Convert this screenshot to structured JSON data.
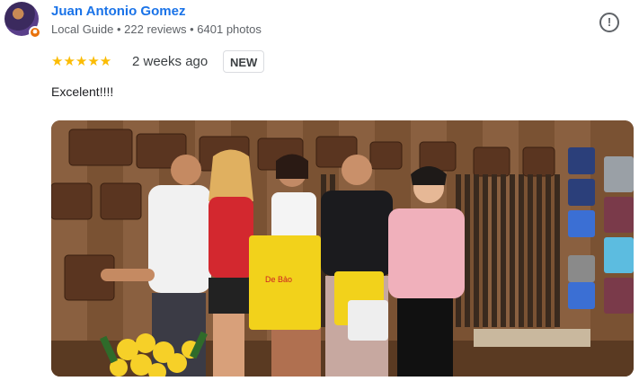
{
  "reviewer": {
    "name": "Juan Antonio Gomez",
    "meta": "Local Guide • 222 reviews • 6401 photos",
    "avatar_icon": "reviewer-avatar",
    "badge_icon": "local-guide-badge-icon"
  },
  "actions": {
    "report_icon": "report-flag-icon",
    "report_glyph": "!"
  },
  "rating": {
    "stars_text": "★★★★★",
    "value": 5,
    "max": 5,
    "color": "#fbbc04"
  },
  "date": "2 weeks ago",
  "badge": "NEW",
  "review_text": "Excelent!!!!",
  "photo": {
    "description_icon": "review-photo",
    "bag_brand_text": "De Bảo"
  },
  "colors": {
    "name": "#1a73e8",
    "meta": "#5f6368",
    "text": "#202124"
  }
}
